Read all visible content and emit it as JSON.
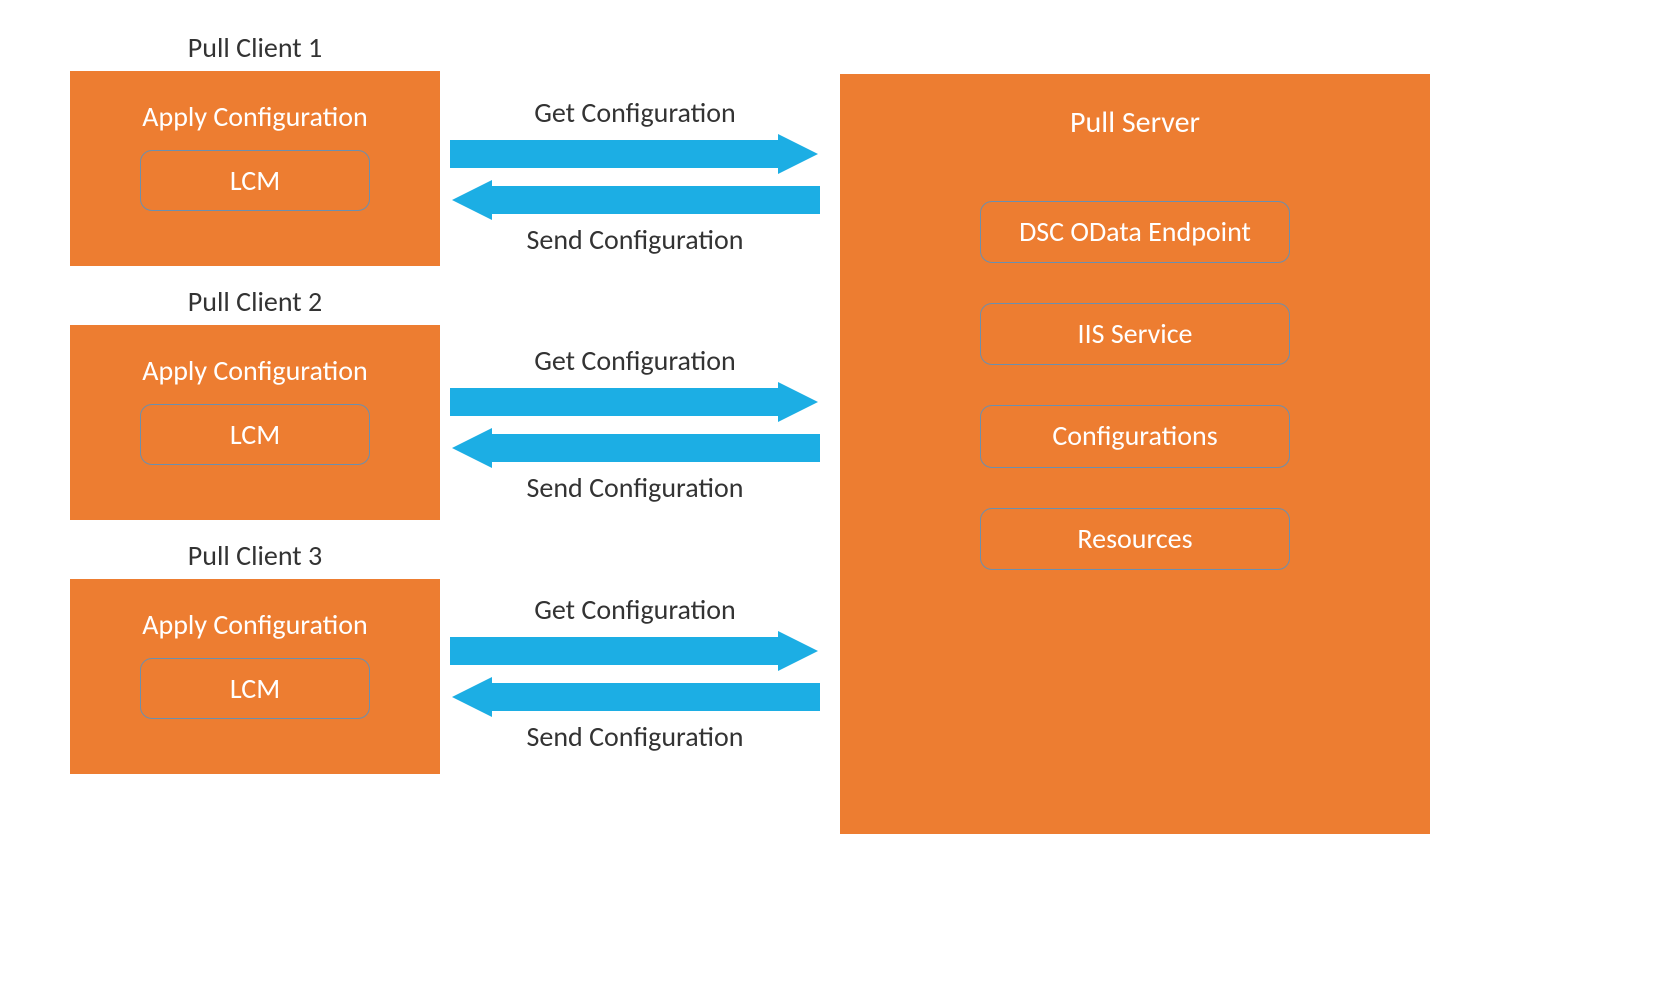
{
  "clients": [
    {
      "title": "Pull Client 1",
      "apply": "Apply Configuration",
      "lcm": "LCM"
    },
    {
      "title": "Pull Client 2",
      "apply": "Apply Configuration",
      "lcm": "LCM"
    },
    {
      "title": "Pull Client 3",
      "apply": "Apply Configuration",
      "lcm": "LCM"
    }
  ],
  "arrows": [
    {
      "top": "Get Configuration",
      "bottom": "Send Configuration"
    },
    {
      "top": "Get Configuration",
      "bottom": "Send Configuration"
    },
    {
      "top": "Get Configuration",
      "bottom": "Send Configuration"
    }
  ],
  "server": {
    "title": "Pull Server",
    "items": [
      "DSC OData Endpoint",
      "IIS Service",
      "Configurations",
      "Resources"
    ]
  },
  "colors": {
    "box": "#ed7d31",
    "arrow": "#1caee4",
    "border": "#6c8fae"
  }
}
